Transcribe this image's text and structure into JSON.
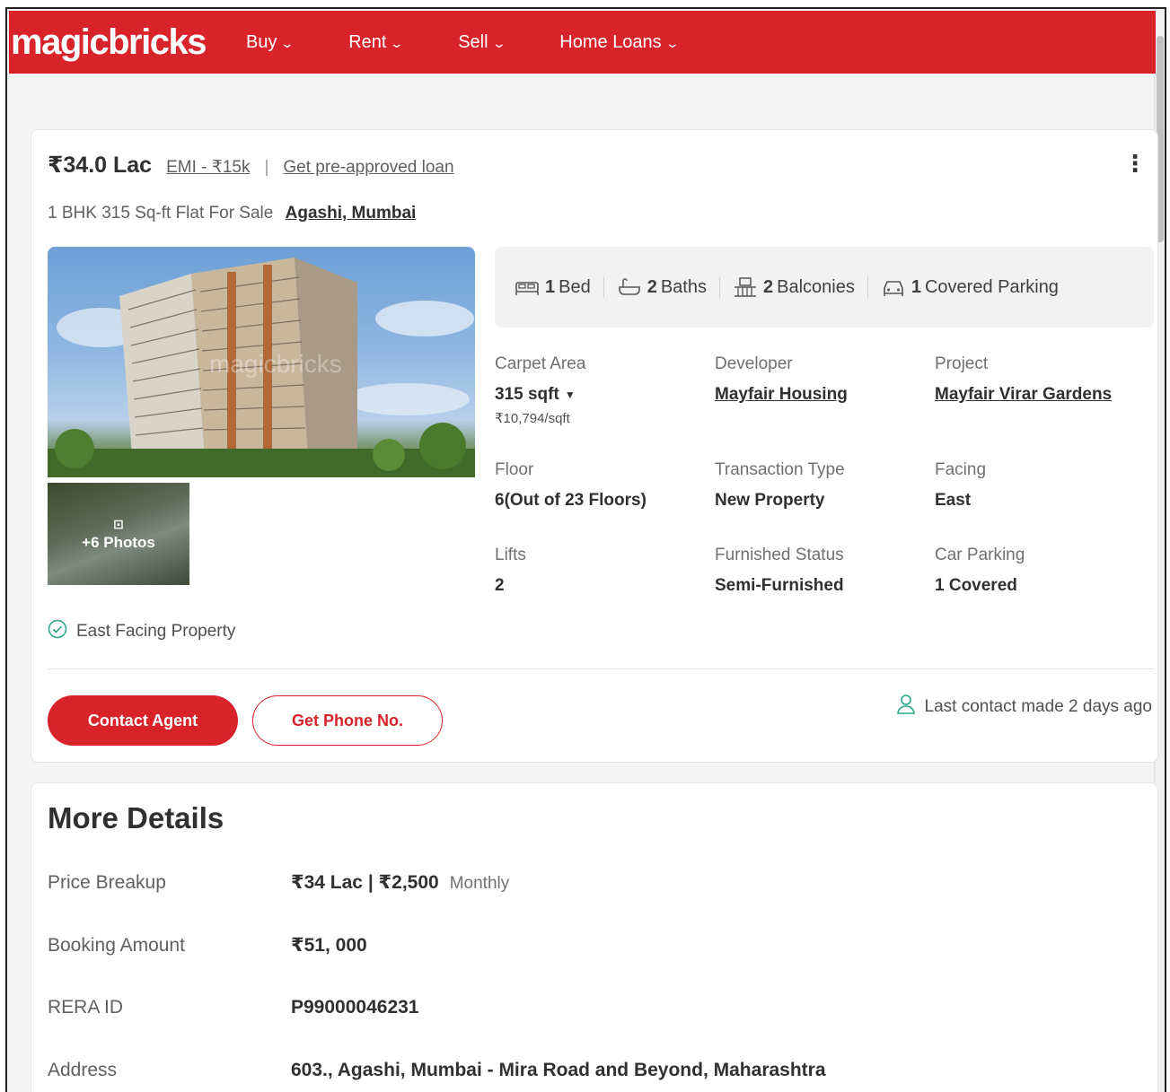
{
  "header": {
    "logo": "magicbricks",
    "nav": [
      {
        "label": "Buy"
      },
      {
        "label": "Rent"
      },
      {
        "label": "Sell"
      },
      {
        "label": "Home Loans"
      }
    ]
  },
  "listing": {
    "price": "₹34.0 Lac",
    "emi": "EMI - ₹15k",
    "separator": "|",
    "loan_link": "Get pre-approved loan",
    "title": "1 BHK 315 Sq-ft Flat For Sale",
    "location": "Agashi, Mumbai",
    "photos_more": "+6 Photos",
    "image_watermark": "magicbricks",
    "stats": [
      {
        "count": "1",
        "label": "Bed",
        "icon": "bed-icon"
      },
      {
        "count": "2",
        "label": "Baths",
        "icon": "bath-icon"
      },
      {
        "count": "2",
        "label": "Balconies",
        "icon": "balcony-icon"
      },
      {
        "count": "1",
        "label": "Covered Parking",
        "icon": "car-icon"
      }
    ],
    "details": {
      "carpet_area": {
        "label": "Carpet Area",
        "value": "315 sqft",
        "sub": "₹10,794/sqft"
      },
      "developer": {
        "label": "Developer",
        "value": "Mayfair Housing"
      },
      "project": {
        "label": "Project",
        "value": "Mayfair Virar Gardens"
      },
      "floor": {
        "label": "Floor",
        "value": "6(Out of 23 Floors)"
      },
      "transaction": {
        "label": "Transaction Type",
        "value": "New Property"
      },
      "facing": {
        "label": "Facing",
        "value": "East"
      },
      "lifts": {
        "label": "Lifts",
        "value": "2"
      },
      "furnished": {
        "label": "Furnished Status",
        "value": "Semi-Furnished"
      },
      "car_parking": {
        "label": "Car Parking",
        "value": "1 Covered"
      }
    },
    "facing_note": "East Facing Property",
    "contact_button": "Contact Agent",
    "phone_button": "Get Phone No.",
    "last_contact": "Last contact made 2 days ago"
  },
  "more_details": {
    "title": "More Details",
    "price_breakup": {
      "label": "Price Breakup",
      "value": "₹34 Lac | ₹2,500",
      "extra": "Monthly"
    },
    "booking": {
      "label": "Booking Amount",
      "value": "₹51, 000"
    },
    "rera": {
      "label": "RERA ID",
      "value": "P99000046231"
    },
    "address": {
      "label": "Address",
      "value": "603., Agashi, Mumbai - Mira Road and Beyond, Maharashtra"
    }
  },
  "colors": {
    "brand": "#d8232a",
    "accent_green": "#2aa58a"
  }
}
